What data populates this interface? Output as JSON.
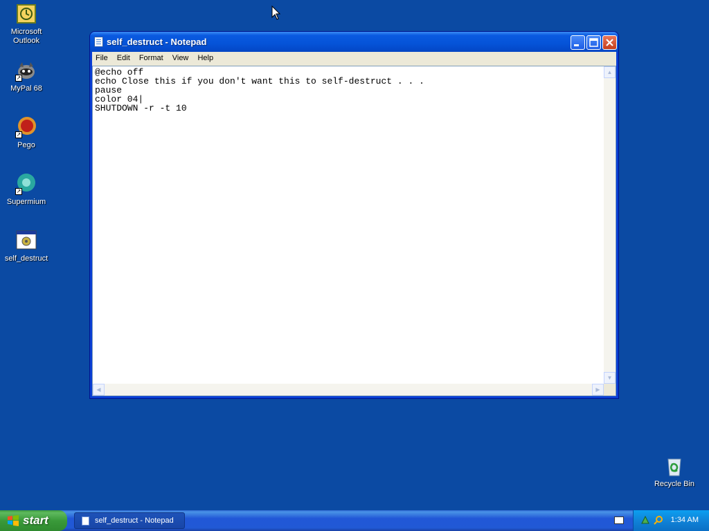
{
  "desktop": {
    "icons": [
      {
        "label": "Microsoft Outlook",
        "icon": "outlook-icon"
      },
      {
        "label": "MyPal 68",
        "icon": "mypal-icon"
      },
      {
        "label": "Pego",
        "icon": "pego-icon"
      },
      {
        "label": "Supermium",
        "icon": "supermium-icon"
      },
      {
        "label": "self_destruct",
        "icon": "batch-file-icon"
      },
      {
        "label": "Recycle Bin",
        "icon": "recycle-bin-icon"
      }
    ]
  },
  "window": {
    "title": "self_destruct - Notepad",
    "menu": [
      "File",
      "Edit",
      "Format",
      "View",
      "Help"
    ],
    "content": "@echo off\necho Close this if you don't want this to self-destruct . . .\npause\ncolor 04|\nSHUTDOWN -r -t 10"
  },
  "taskbar": {
    "start_label": "start",
    "task_item": "self_destruct - Notepad",
    "clock": "1:34 AM"
  },
  "colors": {
    "desktop": "#0b4aa3",
    "titlebar": "#0553d8",
    "start_button": "#3a9a3a"
  }
}
